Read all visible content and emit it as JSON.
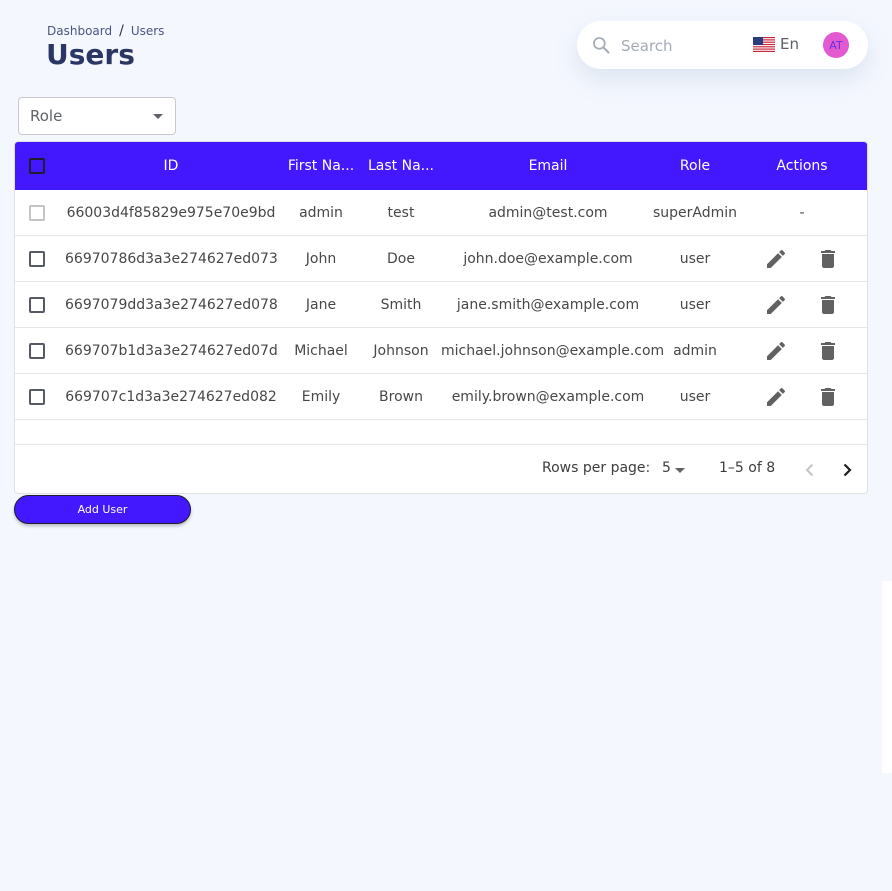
{
  "breadcrumb": {
    "parent": "Dashboard",
    "separator": "/",
    "current": "Users"
  },
  "page_title": "Users",
  "topbar": {
    "search_placeholder": "Search",
    "search_icon": "search-icon",
    "language": "En",
    "language_flag": "us-flag-icon",
    "avatar_initials": "AT",
    "avatar_color": "#e35ad0"
  },
  "filter": {
    "role_label": "Role"
  },
  "table": {
    "header_color": "#4318ff",
    "columns": {
      "id": "ID",
      "first_name": "First Na...",
      "last_name": "Last Na...",
      "email": "Email",
      "role": "Role",
      "actions": "Actions"
    },
    "rows": [
      {
        "id": "66003d4f85829e975e70e9bd",
        "first_name": "admin",
        "last_name": "test",
        "email": "admin@test.com",
        "role": "superAdmin",
        "actions": "-"
      },
      {
        "id": "66970786d3a3e274627ed073",
        "first_name": "John",
        "last_name": "Doe",
        "email": "john.doe@example.com",
        "role": "user",
        "actions": ""
      },
      {
        "id": "6697079dd3a3e274627ed078",
        "first_name": "Jane",
        "last_name": "Smith",
        "email": "jane.smith@example.com",
        "role": "user",
        "actions": ""
      },
      {
        "id": "669707b1d3a3e274627ed07d",
        "first_name": "Michael",
        "last_name": "Johnson",
        "email": "michael.johnson@example.com",
        "role": "admin",
        "actions": ""
      },
      {
        "id": "669707c1d3a3e274627ed082",
        "first_name": "Emily",
        "last_name": "Brown",
        "email": "emily.brown@example.com",
        "role": "user",
        "actions": ""
      }
    ],
    "action_icons": [
      "pencil-icon",
      "trash-icon"
    ]
  },
  "pagination": {
    "rows_per_page_label": "Rows per page:",
    "rows_per_page_value": "5",
    "range": "1–5 of 8"
  },
  "add_user_button": "Add User",
  "accent_color": "#4318ff"
}
